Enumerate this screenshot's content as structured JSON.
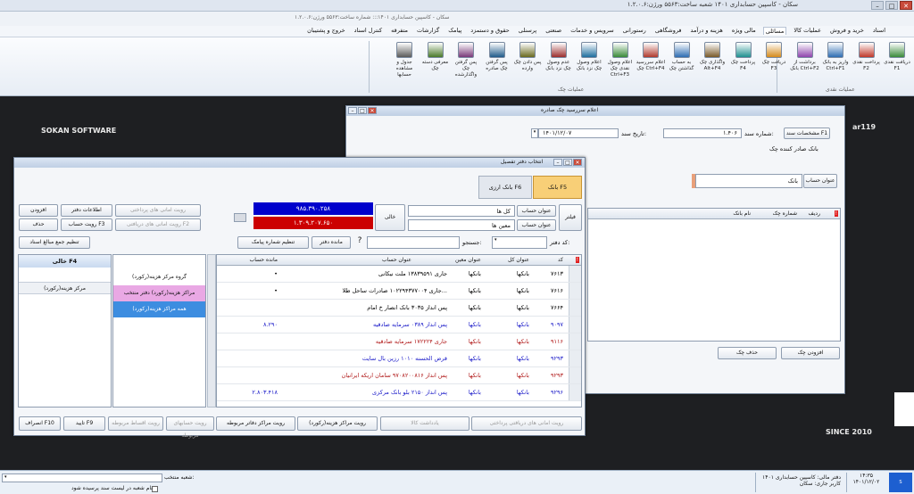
{
  "app": {
    "title": "سکان - کاسپین حسابداری ۱۴۰۱ شعبه ساخت:۵۵۶۳ ورژن:۱.۲.۰.۶",
    "subtitle": "سکان - کاسپین حسابداری ۱۴۰۱::: شماره ساخت:۵۵۶۳ ورژن:۱.۲.۰.۶"
  },
  "menu": {
    "items": [
      "اسناد",
      "خرید و فروش",
      "عملیات کالا",
      "مسائلی",
      "مالی ویژه",
      "هزینه و درآمد",
      "فروشگاهی",
      "رستورانی",
      "سرویس و خدمات",
      "صنعتی",
      "پرسنلی",
      "حقوق و دستمزد",
      "پیامک",
      "گزارشات",
      "متفرقه",
      "کنترل اسناد",
      "خروج و پشتیبان"
    ],
    "active_index": 3
  },
  "ribbon": {
    "buttons": [
      {
        "label": "دریافت نقدی F1",
        "icon": "cash-receive-icon"
      },
      {
        "label": "پرداخت نقدی F2",
        "icon": "cash-pay-icon"
      },
      {
        "label": "واریز به بانک Ctrl+F1",
        "icon": "bank-deposit-icon"
      },
      {
        "label": "برداشت از بانک Ctrl+F2",
        "icon": "bank-withdraw-icon"
      },
      {
        "label": "دریافت چک F3",
        "icon": "check-receive-icon"
      },
      {
        "label": "پرداخت چک F4",
        "icon": "check-pay-icon"
      },
      {
        "label": "واگذاری چک Alt+F4",
        "icon": "check-assign-icon"
      },
      {
        "label": "به حساب گذاشتن چک",
        "icon": "check-account-icon"
      },
      {
        "label": "اعلام سررسید چک Ctrl+F4",
        "icon": "check-due-icon"
      },
      {
        "label": "اعلام وصول نقدی چک Ctrl+F3",
        "icon": "check-collect-icon"
      },
      {
        "label": "اعلام وصول چک نزد بانک",
        "icon": "check-bank-collect-icon"
      },
      {
        "label": "عدم وصول چک نزد بانک",
        "icon": "check-bounce-icon"
      },
      {
        "label": "پس دادن چک وارده",
        "icon": "check-return-in-icon"
      },
      {
        "label": "پس گرفتن چک صادره",
        "icon": "check-return-out-icon"
      },
      {
        "label": "پس گرفتن چک واگذارشده",
        "icon": "check-takeback-icon"
      },
      {
        "label": "معرفی دسته چک",
        "icon": "checkbook-icon"
      },
      {
        "label": "جدول و مشاهده حسابها",
        "icon": "accounts-table-icon"
      }
    ],
    "group1": "عملیات نقدی",
    "group2": "عملیات چک"
  },
  "background": {
    "brand_left": "SOKAN SOFTWARE",
    "brand_right": "SINCE 2010",
    "brand_tag": "ar119"
  },
  "check_window": {
    "title": "اعلام سررسید چک صادره",
    "doc_btn": "مشخصات سند F1",
    "doc_number_label": "شماره سند:",
    "doc_number": "۱.۴۰۶",
    "doc_date_label": "تاریخ سند:",
    "doc_date": "۱۴۰۱/۱۲/۰۷",
    "issuer_bank_label": "بانک صادر کننده چک",
    "account_btn": "عنوان حساب",
    "account_value": "بانک",
    "columns": [
      "ردیف",
      "شماره چک",
      "نام بانک"
    ],
    "add_btn": "افزودن چک",
    "delete_btn": "حذف چک"
  },
  "picker": {
    "title": "انتخاب دفتر تفصیل",
    "tab_bank": "بانک F5",
    "tab_fx": "بانک ارزی F6",
    "filter_label": "فیلتر",
    "account_title_label": "عنوان حساب",
    "account_title_value": "کل ها",
    "moeen_label": "عنوان حساب",
    "moeen_value": "معین ها",
    "balance_label": "خالی",
    "balance_debit": "۹۸۵.۳۹۰.۲۵۸",
    "balance_credit": "۱.۳۰۹.۲۰۷.۶۵۰",
    "right_buttons": {
      "add": "افزودن",
      "book_info": "اطلاعات دفتر",
      "receipt_vouchers": "رویت امانی های پرداختی",
      "del": "حذف",
      "view_account": "رویت حساب F3",
      "received_vouchers": "رویت امانی های دریافتی F2"
    },
    "set_total_btn": "تنظیم جمع مبالغ اسناد",
    "sms_btn": "تنظیم شماره پیامک",
    "book_rem_btn": "مانده دفتر",
    "search_label": "جستجو:",
    "code_label": "کد دفتر:",
    "empty_label": "خالی F4",
    "cost_center_label": "مرکز هزینه(رکورد)",
    "groups": [
      "گروه مرکز هزینه(رکورد)",
      "مراکز هزینه(رکورد) دفتر منتخب",
      "همه مراکز هزینه(رکورد)"
    ],
    "grid_headers": [
      "کد",
      "عنوان کل",
      "عنوان معین",
      "عنوان حساب",
      "مانده حساب"
    ],
    "rows": [
      {
        "code": "۷۶۱۳",
        "kol": "بانکها",
        "moeen": "بانکها",
        "title": "جاری ۱۳۸۳۹۵۹۱ ملت نیکانی",
        "balance": "•",
        "color": "#000000"
      },
      {
        "code": "۷۶۱۶",
        "kol": "بانکها",
        "moeen": "بانکها",
        "title": "جاری ۱۰۲۲۹۴۳۷۷۰۰۴ صادرات ساحل طلا...",
        "balance": "•",
        "color": "#000000"
      },
      {
        "code": "۷۶۶۴",
        "kol": "بانکها",
        "moeen": "بانکها",
        "title": "پس انداز ۳۰۳۵ بانک انصار خ امام",
        "balance": "",
        "color": "#000000"
      },
      {
        "code": "۹۰۹۷",
        "kol": "بانکها",
        "moeen": "بانکها",
        "title": "پس انداز ۰۳۸۹ سرمایه صادقیه",
        "balance": "۸.۲۹۰",
        "color": "#1818c8"
      },
      {
        "code": "۹۱۱۶",
        "kol": "بانکها",
        "moeen": "بانکها",
        "title": "جاری ۱۷۲۲۲۴ سرمایه صادقیه",
        "balance": "",
        "color": "#b01818"
      },
      {
        "code": "۹۲۹۳",
        "kol": "بانکها",
        "moeen": "بانکها",
        "title": "قرض الحسنه ۱۰۱۰ رزین بال سایت",
        "balance": "",
        "color": "#1818c8"
      },
      {
        "code": "۹۲۹۳",
        "kol": "بانکها",
        "moeen": "بانکها",
        "title": "پس انداز ۹۷۰۸۲۰۰۸۱۶ سامان اریکه ایرانیان",
        "balance": "",
        "color": "#b01818"
      },
      {
        "code": "۹۲۹۶",
        "kol": "بانکها",
        "moeen": "بانکها",
        "title": "پس انداز ۲۱۵۰ بلو بانک مرکزی",
        "balance": "۲.۸۰۳.۴۱۸",
        "color": "#1818c8"
      }
    ],
    "bottom_buttons": {
      "receipt_vouchers": "رویت امانی های دریافتی پرداختی",
      "notes": "یادداشت کالا",
      "cost_center": "رویت مراکز هزینه(رکورد)",
      "cost_books": "رویت مراکز دفاتر مربوطه",
      "linked_accounts": "رویت حسابهای مربوطه",
      "installments": "رویت اقساط مربوطه",
      "confirm": "تایید F9",
      "cancel": "انصراف F10"
    }
  },
  "status": {
    "branch_label": "شعبه منتخب:",
    "branch_check": "نام شعبه در لیست سند پرسیده شود",
    "fiscal": "دفتر مالی: کاسپین حسابداری ۱۴۰۱",
    "user": "کاربر جاری: سکان",
    "time": "۱۴:۳۵",
    "date": "۱۴۰۱/۱۲/۰۲"
  }
}
